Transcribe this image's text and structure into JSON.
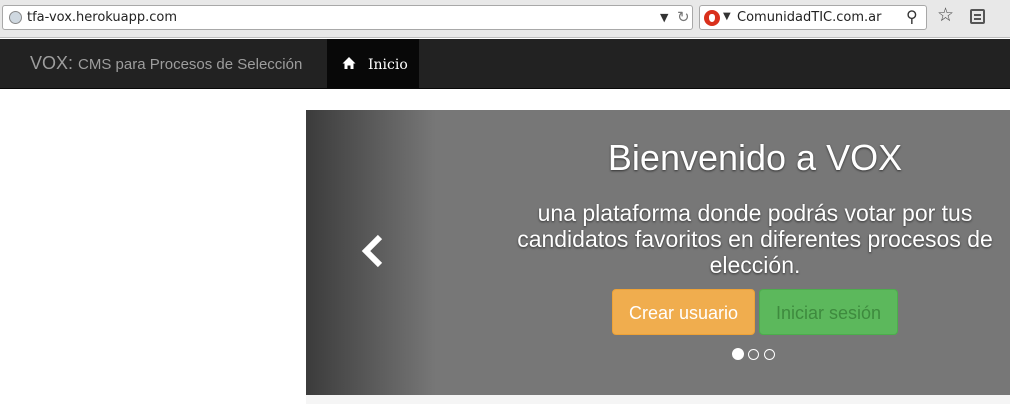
{
  "browser": {
    "url": "tfa-vox.herokuapp.com",
    "search_text": "ComunidadTIC.com.ar",
    "icons": [
      "globe-icon",
      "dropdown-arrow-icon",
      "reload-icon",
      "search-engine-icon",
      "search-icon",
      "star-icon",
      "bookmarks-icon"
    ]
  },
  "navbar": {
    "brand": "VOX:",
    "brand_sub": "CMS para Procesos de Selección",
    "items": [
      {
        "label": "Inicio",
        "icon": "home-icon",
        "active": true
      }
    ]
  },
  "carousel": {
    "title": "Bienvenido a VOX",
    "text": "una plataforma donde podrás votar por tus candidatos favoritos en diferentes procesos de elección.",
    "buttons": [
      {
        "label": "Crear usuario",
        "color": "#f0ad4e"
      },
      {
        "label": "Iniciar sesión",
        "color": "#5cb85c"
      }
    ],
    "slides": 3,
    "active_slide": 1
  },
  "colors": {
    "navbar": "#222222",
    "active_nav": "#080808",
    "carousel_bg": "#777777"
  }
}
